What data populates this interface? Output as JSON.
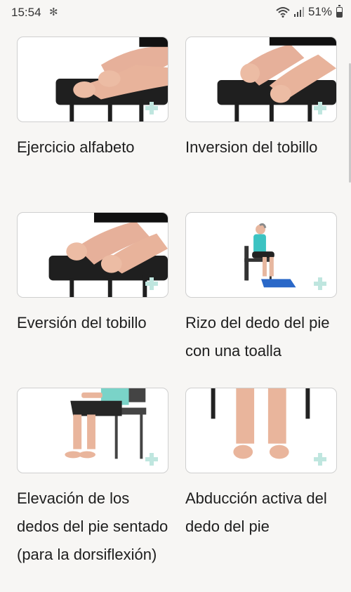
{
  "status_bar": {
    "time": "15:54",
    "bluetooth_icon": "bluetooth-icon",
    "battery": "51%",
    "battery_level": 0.51
  },
  "exercises": [
    {
      "title": "Ejercicio alfabeto",
      "image": "feet-on-bench-image"
    },
    {
      "title": "Inversion del tobillo",
      "image": "feet-on-bench-image"
    },
    {
      "title": "Eversión del tobillo",
      "image": "feet-on-bench-image"
    },
    {
      "title": "Rizo del dedo del pie con una toalla",
      "image": "seated-towel-image"
    },
    {
      "title": "Elevación de los dedos del pie sentado (para la dorsiflexión)",
      "image": "seated-legs-image"
    },
    {
      "title": "Abducción activa del dedo del pie",
      "image": "standing-feet-image"
    }
  ],
  "colors": {
    "background": "#f7f6f4",
    "plus_accent": "#bfe6df",
    "skin": "#e9b59c",
    "bench": "#222222"
  }
}
